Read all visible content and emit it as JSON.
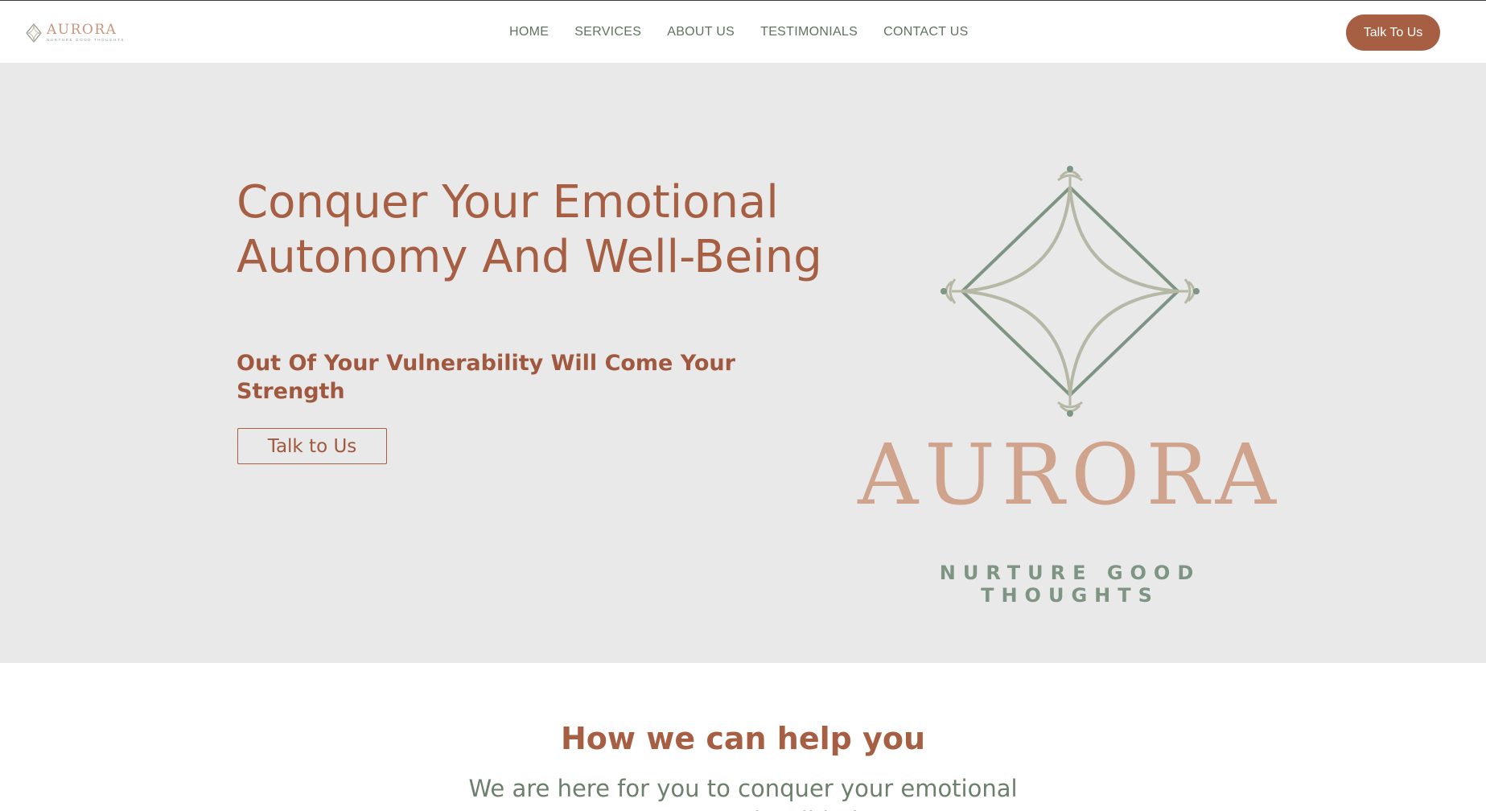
{
  "brand": {
    "name": "AURORA",
    "tagline": "NURTURE GOOD THOUGHTS"
  },
  "nav": {
    "items": [
      "HOME",
      "SERVICES",
      "ABOUT US",
      "TESTIMONIALS",
      "CONTACT US"
    ],
    "cta_label": "Talk To Us"
  },
  "hero": {
    "title": "Conquer Your Emotional Autonomy And Well-Being",
    "subtitle": "Out Of Your Vulnerability Will Come Your Strength",
    "button_label": "Talk to Us",
    "logo_word": "AURORA",
    "logo_tagline": "NURTURE GOOD THOUGHTS"
  },
  "help": {
    "title": "How we can help you",
    "text": "We are here for you to conquer your emotional autonomy and well-being."
  },
  "colors": {
    "accent": "#a75f43",
    "sage": "#7f9583",
    "hero_bg": "#e9e9e9",
    "logo_peach": "#d0a38d"
  }
}
